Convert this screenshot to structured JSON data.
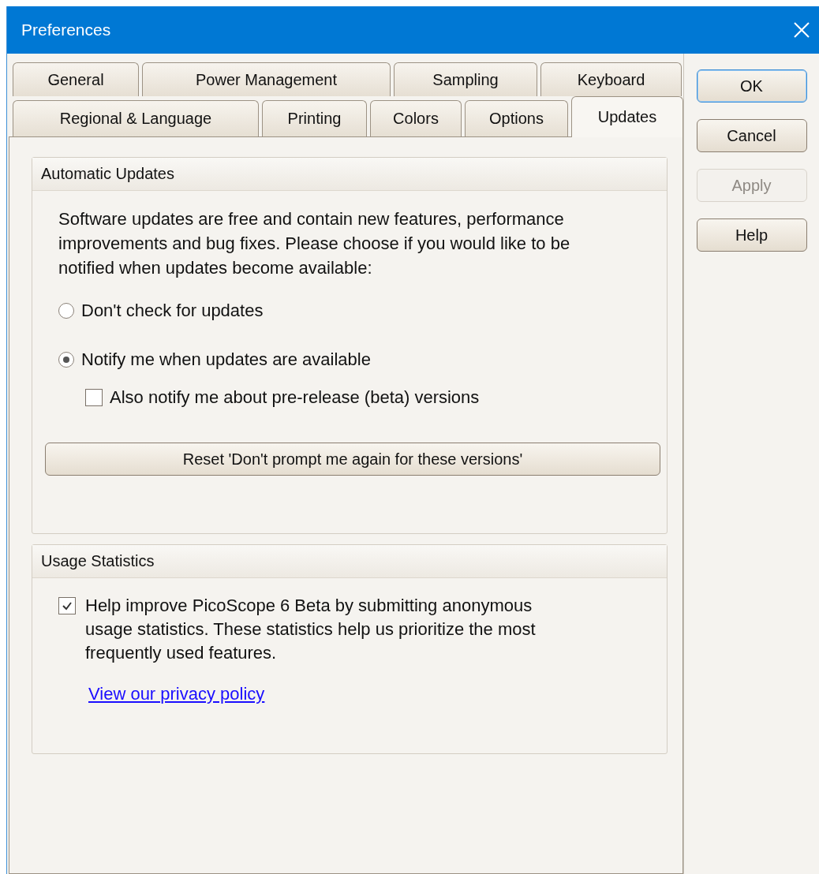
{
  "window": {
    "title": "Preferences"
  },
  "tab_rows": [
    [
      {
        "label": "General",
        "selected": false
      },
      {
        "label": "Power Management",
        "selected": false
      },
      {
        "label": "Sampling",
        "selected": false
      },
      {
        "label": "Keyboard",
        "selected": false
      }
    ],
    [
      {
        "label": "Regional & Language",
        "selected": false
      },
      {
        "label": "Printing",
        "selected": false
      },
      {
        "label": "Colors",
        "selected": false
      },
      {
        "label": "Options",
        "selected": false
      },
      {
        "label": "Updates",
        "selected": true
      }
    ]
  ],
  "automatic_updates": {
    "title": "Automatic Updates",
    "description": "Software updates are free and contain new features, performance improvements and bug fixes. Please choose if you would like to be notified when updates become available:",
    "options": [
      {
        "label": "Don't check for updates",
        "selected": false
      },
      {
        "label": "Notify me when updates are available",
        "selected": true
      }
    ],
    "beta_checkbox": {
      "label": "Also notify me about pre-release (beta) versions",
      "checked": false
    },
    "reset_button": "Reset 'Don't prompt me again for these versions'"
  },
  "usage_statistics": {
    "title": "Usage Statistics",
    "checkbox": {
      "label": "Help improve PicoScope 6 Beta by submitting anonymous usage statistics. These statistics help us prioritize the most frequently used features.",
      "checked": true
    },
    "link": "View our privacy policy"
  },
  "buttons": [
    {
      "label": "OK",
      "default": true,
      "disabled": false
    },
    {
      "label": "Cancel",
      "default": false,
      "disabled": false
    },
    {
      "label": "Apply",
      "default": false,
      "disabled": true
    },
    {
      "label": "Help",
      "default": false,
      "disabled": false
    }
  ]
}
